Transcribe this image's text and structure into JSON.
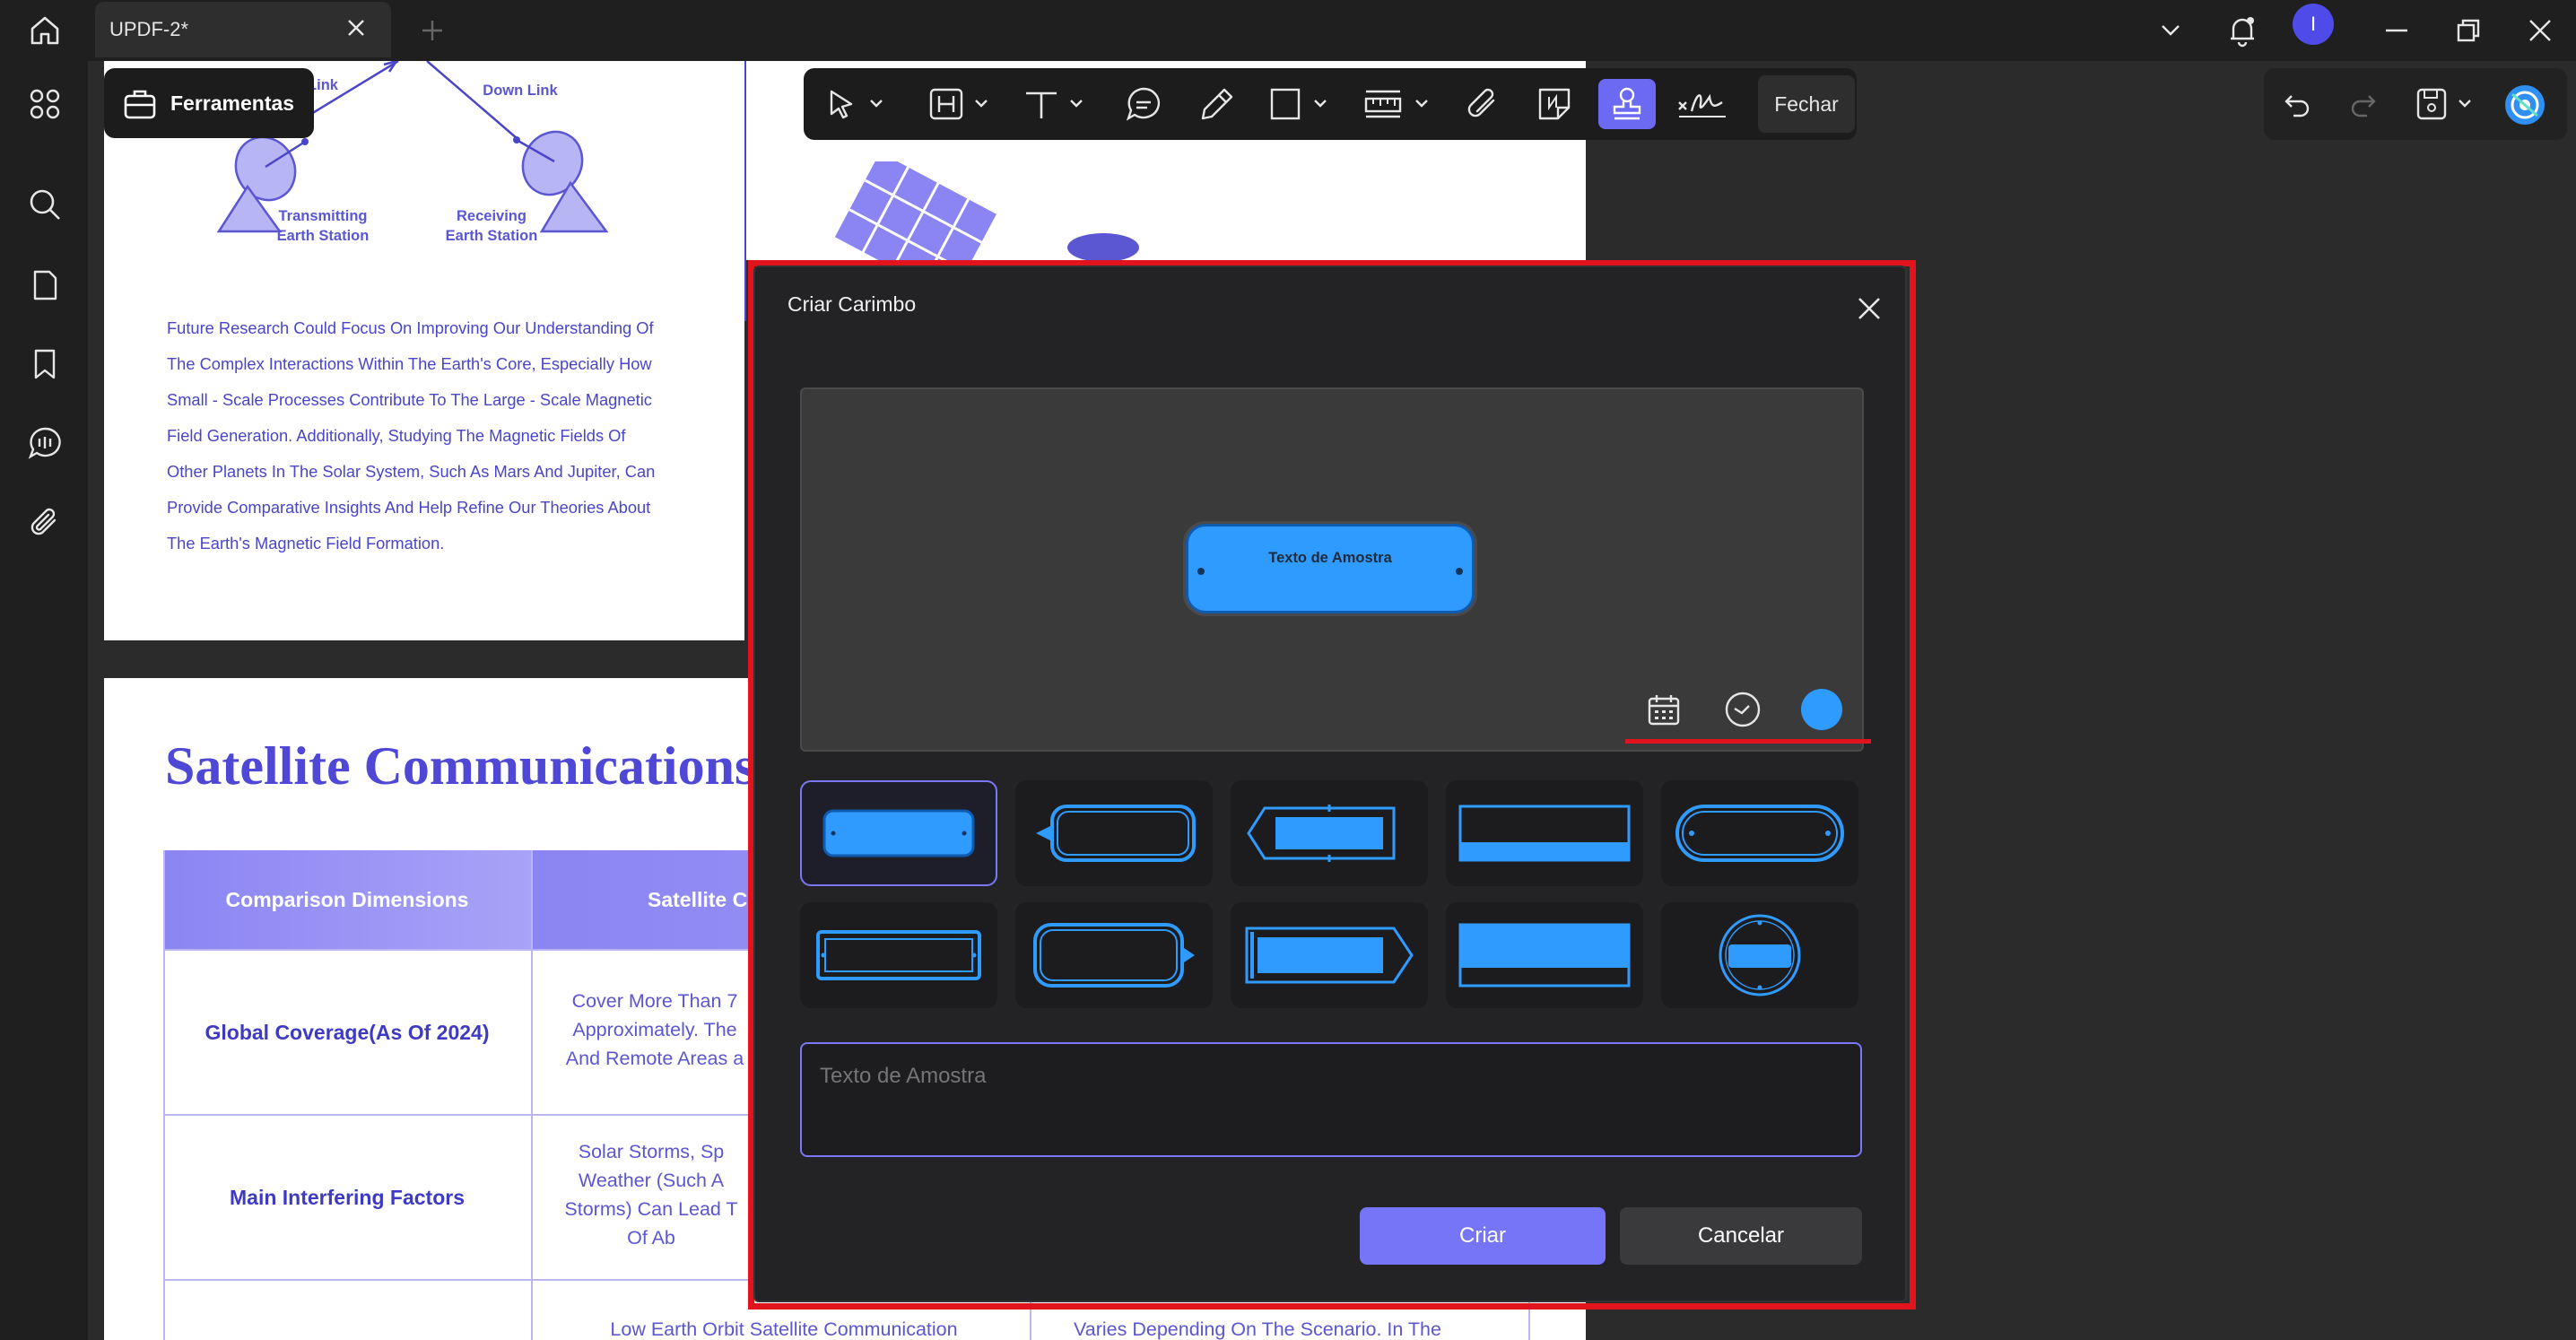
{
  "tab": {
    "title": "UPDF-2*"
  },
  "user": {
    "initial": "I"
  },
  "tools_chip": {
    "label": "Ferramentas"
  },
  "toolbar": {
    "close_label": "Fechar"
  },
  "page1": {
    "link_left": "Link",
    "link_right": "Down Link",
    "station_left": [
      "Transmitting",
      "Earth Station"
    ],
    "station_right": [
      "Receiving",
      "Earth Station"
    ],
    "body_lines": [
      "Future Research Could Focus On Improving Our Understanding Of",
      "The Complex Interactions Within The Earth's Core, Especially How",
      "Small - Scale Processes Contribute To The Large - Scale Magnetic",
      "Field Generation. Additionally, Studying The Magnetic Fields Of",
      "Other Planets In The Solar System, Such As Mars And Jupiter, Can",
      "Provide Comparative Insights And Help Refine Our Theories About",
      "The Earth's Magnetic Field Formation."
    ]
  },
  "page2": {
    "title": "Satellite Communications",
    "table": {
      "headers": [
        "Comparison Dimensions",
        "Satellite C"
      ],
      "rows": [
        {
          "label": "Global Coverage(As Of 2024)",
          "cell": [
            "Cover More Than 7",
            "Approximately. The",
            "And Remote Areas a"
          ]
        },
        {
          "label": "Main Interfering Factors",
          "cell": [
            "Solar Storms, Sp",
            "Weather (Such A",
            "Storms) Can Lead T",
            "Of Ab"
          ]
        }
      ],
      "last_row": {
        "cell2": "Low Earth Orbit Satellite Communication",
        "cell3_top": "",
        "cell3": "Varies Depending On The Scenario. In The"
      }
    }
  },
  "dialog": {
    "title": "Criar Carimbo",
    "preview_text": "Texto de Amostra",
    "input_placeholder": "Texto de Amostra",
    "create_label": "Criar",
    "cancel_label": "Cancelar",
    "stamp_color": "#2f9bff",
    "templates": [
      "rounded-filled",
      "tag-left-outline",
      "double-bracket-filled",
      "banner-bottom",
      "pill-outline",
      "dotted-rect-outline",
      "tag-right-outline",
      "arrow-right-filled",
      "banner-bottom-filled",
      "round-seal"
    ]
  },
  "colors": {
    "accent": "#6c6af2",
    "highlight": "#e1141e",
    "page_text": "#4a45c9"
  }
}
